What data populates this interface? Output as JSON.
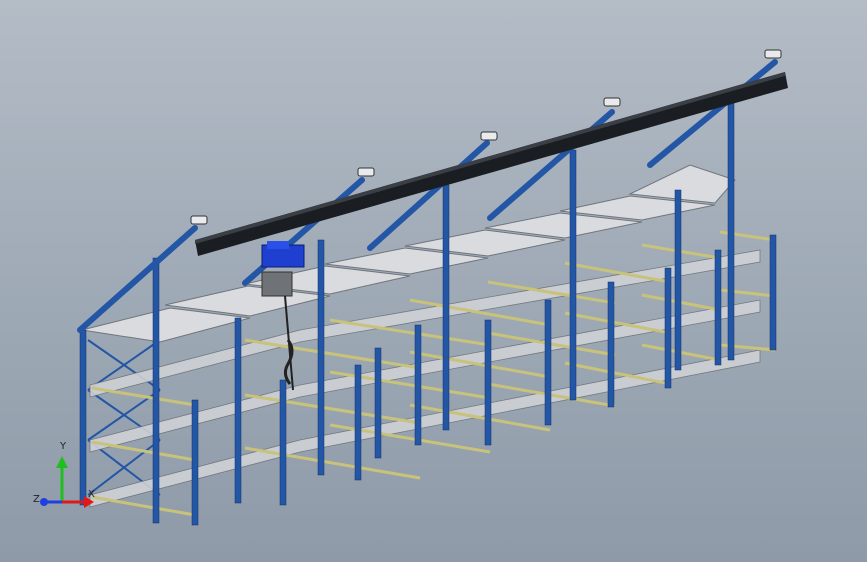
{
  "viewport": {
    "background_top": "#b4bcc6",
    "background_bottom": "#8e9aa8"
  },
  "model": {
    "frame_color": "#2456a6",
    "rail_color": "#c8c27a",
    "deck_color": "#d9dbde",
    "beam_color": "#1a1d22",
    "hoist_color": "#1f3fd0"
  },
  "triad": {
    "x_label": "X",
    "y_label": "Y",
    "z_label": "Z",
    "x_color": "#e01818",
    "y_color": "#1fbf1f",
    "z_color": "#1f3fe0"
  }
}
